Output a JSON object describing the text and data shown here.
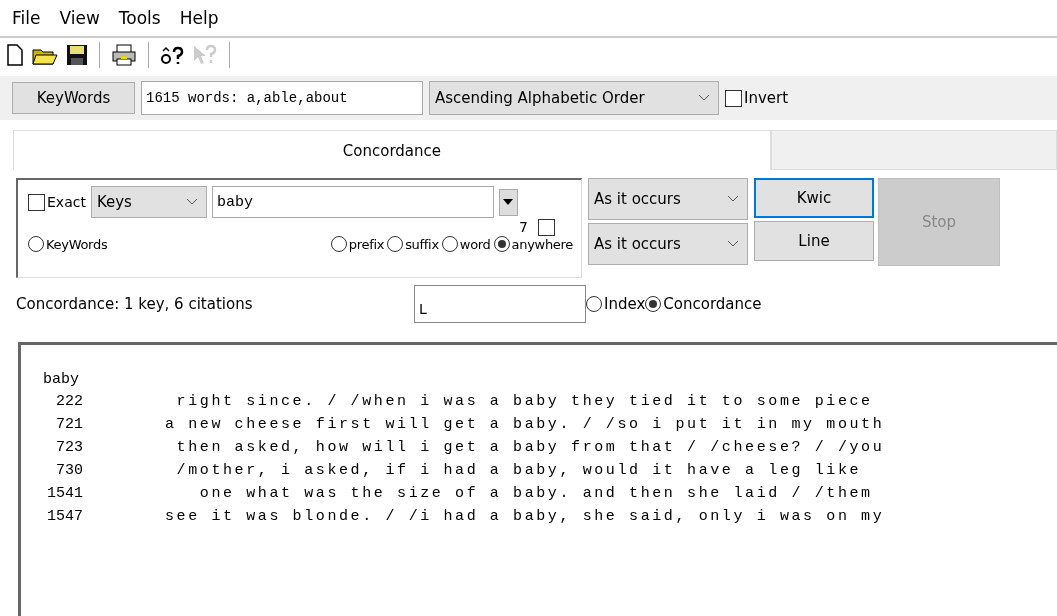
{
  "menu": [
    "File",
    "View",
    "Tools",
    "Help"
  ],
  "keywords_button": "KeyWords",
  "keywords_field": {
    "value": "1615 words: a,able,about"
  },
  "order_select": {
    "value": "Ascending Alphabetic Order"
  },
  "invert": {
    "label": "Invert",
    "checked": false
  },
  "tabs": [
    {
      "label": "Concordance",
      "selected": true
    },
    {
      "selected": false
    }
  ],
  "search": {
    "exact": {
      "label": "Exact",
      "checked": false
    },
    "scope": {
      "value": "Keys"
    },
    "query": {
      "value": "baby"
    },
    "count": "7",
    "count_checked": false,
    "keywords_radio": {
      "label": "KeyWords",
      "selected": false
    },
    "match": [
      {
        "label": "prefix",
        "selected": false
      },
      {
        "label": "suffix",
        "selected": false
      },
      {
        "label": "word",
        "selected": false
      },
      {
        "label": "anywhere",
        "selected": true
      }
    ]
  },
  "sort_selects": [
    {
      "value": "As it occurs"
    },
    {
      "value": "As it occurs"
    }
  ],
  "buttons": [
    {
      "label": "Kwic",
      "focused": true,
      "disabled": false
    },
    {
      "label": "Line",
      "focused": false,
      "disabled": false
    }
  ],
  "stop_button": {
    "label": "Stop",
    "disabled": true
  },
  "status": "Concordance: 1 key, 6 citations",
  "filter_field": {
    "value": "L"
  },
  "view_mode": [
    {
      "label": "Index",
      "selected": false
    },
    {
      "label": "Concordance",
      "selected": true
    }
  ],
  "output": {
    "heading": "baby",
    "lines": [
      {
        "number": "222",
        "text": " right since. / /when i was a baby they tied it to some piece"
      },
      {
        "number": "721",
        "text": "a new cheese first will get a baby. / /so i put it in my mouth"
      },
      {
        "number": "723",
        "text": " then asked, how will i get a baby from that / /cheese? / /you"
      },
      {
        "number": "730",
        "text": " /mother, i asked, if i had a baby, would it have a leg like"
      },
      {
        "number": "1541",
        "text": "   one what was the size of a baby. and then she laid / /them"
      },
      {
        "number": "1547",
        "text": "see it was blonde. / /i had a baby, she said, only i was on my"
      }
    ]
  }
}
